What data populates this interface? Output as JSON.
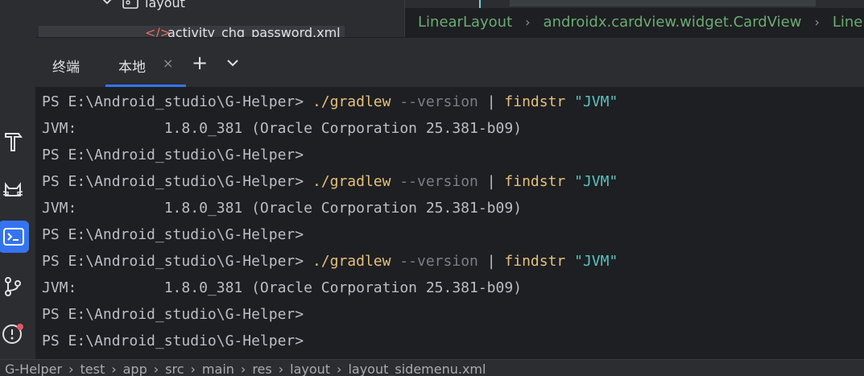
{
  "project_tree": {
    "folder_label": "layout",
    "file_label": "activity_chg_password.xml"
  },
  "breadcrumb": {
    "items": [
      "LinearLayout",
      "androidx.cardview.widget.CardView",
      "Line"
    ]
  },
  "terminal_panel": {
    "title": "终端",
    "tab_label": "本地",
    "close_glyph": "×",
    "add_glyph": "+"
  },
  "terminal": {
    "prompt": "PS E:\\Android_studio\\G-Helper> ",
    "prompt_bare": "PS E:\\Android_studio\\G-Helper>",
    "cmd": "./gradlew",
    "opt": " --version ",
    "pipe": "| ",
    "filter": "findstr",
    "arg": " \"JVM\"",
    "jvm_output": "JVM:          1.8.0_381 (Oracle Corporation 25.381-b09)"
  },
  "status_bar": {
    "items": [
      "G-Helper",
      "test",
      "app",
      "src",
      "main",
      "res",
      "layout",
      "layout_sidemenu.xml"
    ]
  },
  "colors": {
    "accent": "#3574f0",
    "xml_tag": "#6aab73",
    "command": "#e5c07b",
    "string": "#56c2c2"
  },
  "icons": [
    "hammer-icon",
    "cat-icon",
    "terminal-icon",
    "git-branch-icon",
    "problems-icon"
  ]
}
